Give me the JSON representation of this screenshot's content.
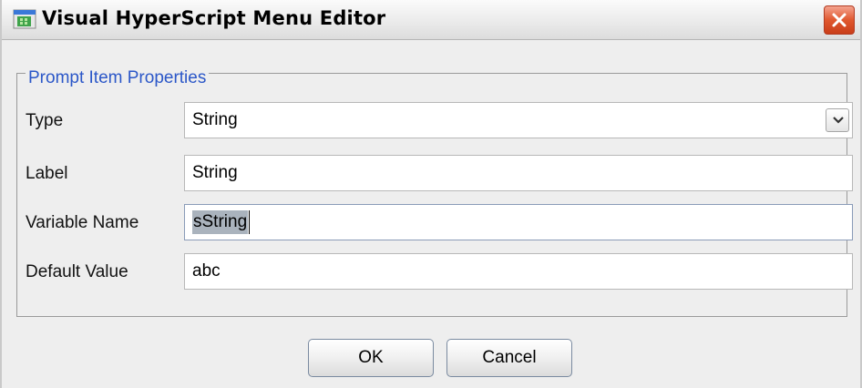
{
  "window": {
    "title": "Visual HyperScript Menu Editor",
    "icon": "app-icon",
    "close_icon": "close-icon"
  },
  "group": {
    "title": "Prompt Item Properties",
    "title_color": "#2b57c8"
  },
  "fields": {
    "type": {
      "label": "Type",
      "value": "String"
    },
    "label": {
      "label": "Label",
      "value": "String"
    },
    "variable_name": {
      "label": "Variable Name",
      "value": "sString"
    },
    "default_value": {
      "label": "Default Value",
      "value": "abc"
    }
  },
  "buttons": {
    "ok": "OK",
    "cancel": "Cancel"
  }
}
